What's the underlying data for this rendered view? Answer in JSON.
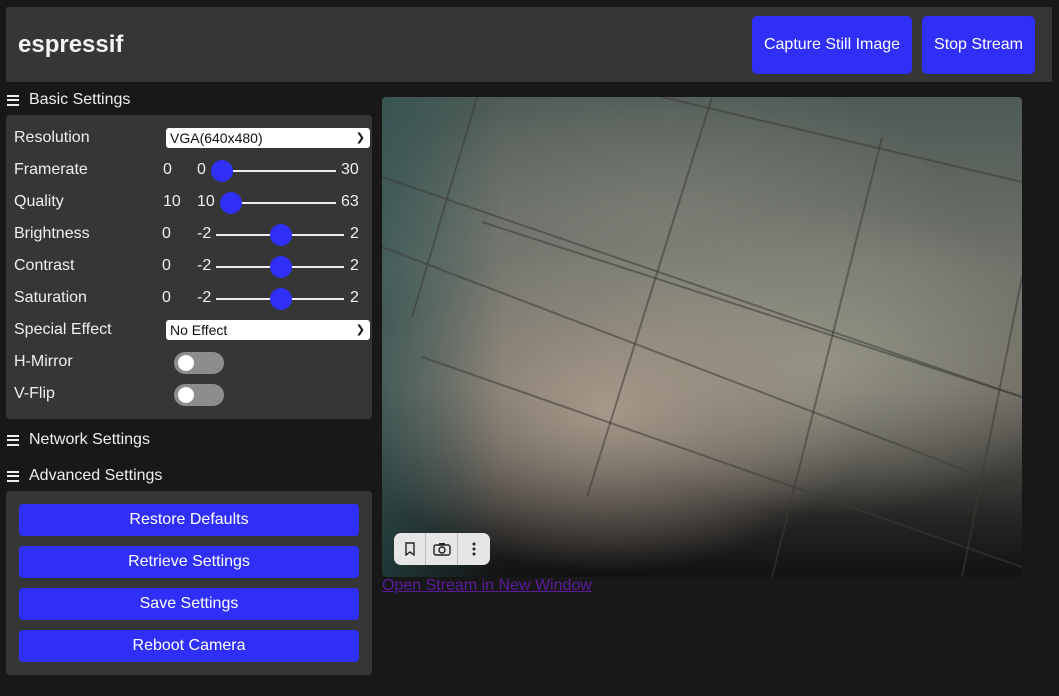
{
  "header": {
    "title": "espressif",
    "capture_label": "Capture Still Image",
    "stop_label": "Stop Stream"
  },
  "basic": {
    "heading": "Basic Settings",
    "resolution": {
      "label": "Resolution",
      "value": "VGA(640x480)"
    },
    "framerate": {
      "label": "Framerate",
      "value": "0",
      "min": "0",
      "max": "30"
    },
    "quality": {
      "label": "Quality",
      "value": "10",
      "min": "10",
      "max": "63"
    },
    "brightness": {
      "label": "Brightness",
      "value": "0",
      "min": "-2",
      "max": "2"
    },
    "contrast": {
      "label": "Contrast",
      "value": "0",
      "min": "-2",
      "max": "2"
    },
    "saturation": {
      "label": "Saturation",
      "value": "0",
      "min": "-2",
      "max": "2"
    },
    "special_effect": {
      "label": "Special Effect",
      "value": "No Effect"
    },
    "hmirror": {
      "label": "H-Mirror",
      "on": false
    },
    "vflip": {
      "label": "V-Flip",
      "on": false
    }
  },
  "network": {
    "heading": "Network Settings"
  },
  "advanced": {
    "heading": "Advanced Settings",
    "restore": "Restore Defaults",
    "retrieve": "Retrieve Settings",
    "save": "Save Settings",
    "reboot": "Reboot Camera"
  },
  "stream": {
    "link_text": "Open Stream in New Window",
    "overlay_icons": [
      "bookmark-icon",
      "camera-search-icon",
      "more-vertical-icon"
    ]
  },
  "colors": {
    "accent": "#2f2ff8",
    "panel": "#363636",
    "background": "#181818"
  }
}
